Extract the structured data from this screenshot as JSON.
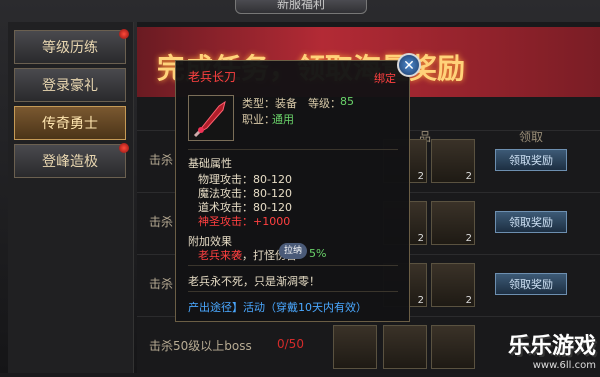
{
  "header": {
    "tab_title": "新服福利"
  },
  "sidebar": {
    "items": [
      {
        "label": "等级历练"
      },
      {
        "label": "登录豪礼"
      },
      {
        "label": "传奇勇士"
      },
      {
        "label": "登峰造极"
      }
    ]
  },
  "banner": {
    "text": "完成任务，领取海量奖励"
  },
  "table": {
    "col_items": "品",
    "col_claim": "领取"
  },
  "tasks": [
    {
      "label": "击杀",
      "progress": "",
      "claim": "领取奖励",
      "counts": [
        "2",
        "2"
      ]
    },
    {
      "label": "击杀",
      "progress": "",
      "claim": "领取奖励",
      "counts": [
        "2",
        "2"
      ]
    },
    {
      "label": "击杀",
      "progress": "",
      "claim": "领取奖励",
      "counts": [
        "2",
        "2"
      ]
    },
    {
      "label": "击杀50级以上boss",
      "progress": "0/50",
      "claim": "",
      "counts": [
        "",
        ""
      ]
    }
  ],
  "tooltip": {
    "title": "老兵长刀",
    "bind": "绑定",
    "close": "✕",
    "type_label": "类型：装备",
    "level_label": "等级：",
    "level_value": "85",
    "job_label": "职业：",
    "job_value": "通用",
    "base_header": "基础属性",
    "attrs": [
      "物理攻击：80-120",
      "魔法攻击：80-120",
      "道术攻击：80-120"
    ],
    "holy_attr": "神圣攻击：+1000",
    "extra_header": "附加效果",
    "extra_effect_name": "老兵来袭",
    "extra_effect_text": "，打怪伤害",
    "extra_effect_pill": "拉纳",
    "extra_effect_value": "5%",
    "flavor": "老兵永不死，只是渐凋零！",
    "source": "产出途径】活动（穿戴10天内有效）"
  },
  "watermark": {
    "big": "乐乐游戏",
    "small": "www.6ll.com"
  }
}
